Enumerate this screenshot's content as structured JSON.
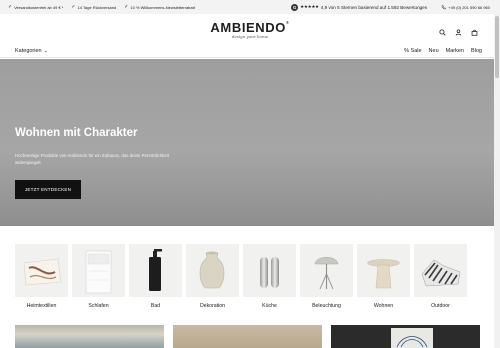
{
  "usp": [
    {
      "icon": "check-icon",
      "text": "Versandkostenfrei ab 49 € *"
    },
    {
      "icon": "check-icon",
      "text": "14 Tage Rückversand"
    },
    {
      "icon": "check-icon",
      "text": "10 % Willkommens-Newsletterrabatt"
    }
  ],
  "rating": {
    "text": "4,9 von 5 Sternen basierend auf 1.592 Bewertungen",
    "stars": "★★★★★",
    "logo_letter": "G"
  },
  "phone": "+49 (0) 201 590 66 960",
  "logo": {
    "brand": "AMBIENDO",
    "reg": "®",
    "tagline": "design your home"
  },
  "nav": {
    "categories": "Kategorien",
    "categories_arrow": "⌄",
    "items": [
      "% Sale",
      "Neu",
      "Marken",
      "Blog"
    ]
  },
  "hero": {
    "title": "Wohnen mit Charakter",
    "text": "Hochwertige Produkte von Ambiendo für ein Zuhause, das deine Persönlichkeit widerspiegelt",
    "button": "JETZT ENTDECKEN"
  },
  "categories": [
    "Heimtextilien",
    "Schlafen",
    "Bad",
    "Dekoration",
    "Küche",
    "Beleuchtung",
    "Wohnen",
    "Outdoor"
  ],
  "colors": {
    "accent": "#111111",
    "hero_bg": "#a3a3a3",
    "tile_bg": "#f1f1ef"
  }
}
